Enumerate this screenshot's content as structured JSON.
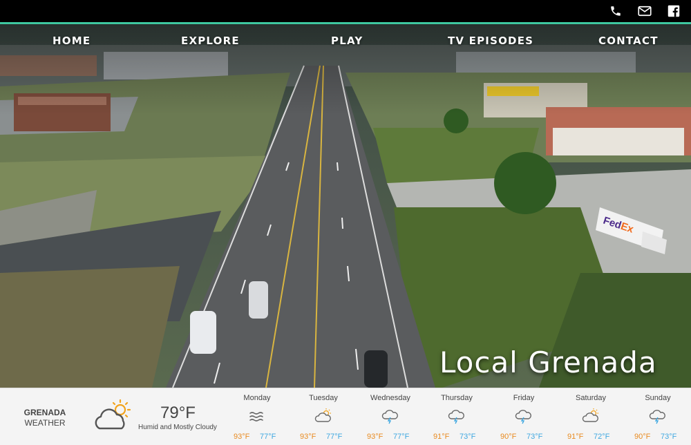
{
  "header": {
    "icons": [
      "phone-icon",
      "mail-icon",
      "facebook-icon"
    ],
    "accent_color": "#3ec8a0"
  },
  "nav": {
    "items": [
      {
        "label": "HOME"
      },
      {
        "label": "EXPLORE"
      },
      {
        "label": "PLAY"
      },
      {
        "label": "TV EPISODES"
      },
      {
        "label": "CONTACT"
      }
    ]
  },
  "hero": {
    "title": "Local Grenada"
  },
  "weather": {
    "city": "GRENADA",
    "label": "WEATHER",
    "current_temp": "79°F",
    "current_desc": "Humid and Mostly Cloudy",
    "current_icon": "partly-cloudy-icon",
    "hi_color": "#e88a1f",
    "lo_color": "#3ea7e0",
    "days": [
      {
        "name": "Monday",
        "hi": "93°F",
        "lo": "77°F",
        "icon": "fog-icon"
      },
      {
        "name": "Tuesday",
        "hi": "93°F",
        "lo": "77°F",
        "icon": "partly-cloudy-icon"
      },
      {
        "name": "Wednesday",
        "hi": "93°F",
        "lo": "77°F",
        "icon": "thunderstorm-icon"
      },
      {
        "name": "Thursday",
        "hi": "91°F",
        "lo": "73°F",
        "icon": "thunderstorm-icon"
      },
      {
        "name": "Friday",
        "hi": "90°F",
        "lo": "73°F",
        "icon": "thunderstorm-icon"
      },
      {
        "name": "Saturday",
        "hi": "91°F",
        "lo": "72°F",
        "icon": "partly-cloudy-icon"
      },
      {
        "name": "Sunday",
        "hi": "90°F",
        "lo": "73°F",
        "icon": "thunderstorm-icon"
      }
    ]
  }
}
